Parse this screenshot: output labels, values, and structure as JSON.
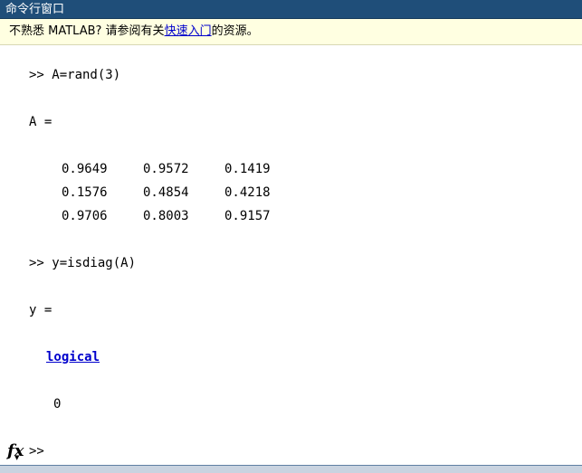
{
  "window": {
    "title": "命令行窗口"
  },
  "infobar": {
    "prefix": "不熟悉 MATLAB? 请参阅有关",
    "link": "快速入门",
    "suffix": "的资源。"
  },
  "session": {
    "cmd1": ">> A=rand(3)",
    "a_header": "A =",
    "matrix_A": [
      [
        "0.9649",
        "0.9572",
        "0.1419"
      ],
      [
        "0.1576",
        "0.4854",
        "0.4218"
      ],
      [
        "0.9706",
        "0.8003",
        "0.9157"
      ]
    ],
    "cmd2": ">> y=isdiag(A)",
    "y_header": "y =",
    "y_type_link": "logical",
    "y_value": "0"
  },
  "prompt": {
    "fx_label": "fx",
    "symbol": ">>",
    "value": ""
  },
  "colors": {
    "title_bg": "#1f4e79",
    "infobar_bg": "#ffffe1",
    "link": "#0000cc"
  }
}
